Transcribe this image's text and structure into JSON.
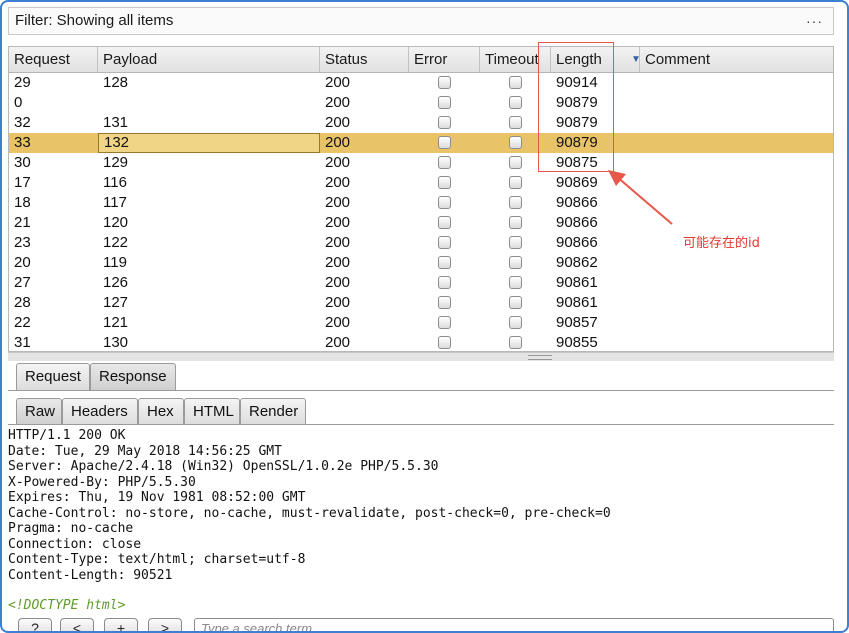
{
  "filter": {
    "text": "Filter: Showing all items",
    "menu": "···"
  },
  "columns": [
    {
      "key": "request",
      "label": "Request"
    },
    {
      "key": "payload",
      "label": "Payload"
    },
    {
      "key": "status",
      "label": "Status"
    },
    {
      "key": "error",
      "label": "Error"
    },
    {
      "key": "timeout",
      "label": "Timeout"
    },
    {
      "key": "length",
      "label": "Length",
      "sorted": "desc"
    },
    {
      "key": "comment",
      "label": "Comment"
    }
  ],
  "sort_icon": "sort-desc-icon",
  "rows": [
    {
      "request": "29",
      "payload": "128",
      "status": "200",
      "length": "90914",
      "selected": false
    },
    {
      "request": "0",
      "payload": "",
      "status": "200",
      "length": "90879",
      "selected": false
    },
    {
      "request": "32",
      "payload": "131",
      "status": "200",
      "length": "90879",
      "selected": false
    },
    {
      "request": "33",
      "payload": "132",
      "status": "200",
      "length": "90879",
      "selected": true
    },
    {
      "request": "30",
      "payload": "129",
      "status": "200",
      "length": "90875",
      "selected": false
    },
    {
      "request": "17",
      "payload": "116",
      "status": "200",
      "length": "90869",
      "selected": false
    },
    {
      "request": "18",
      "payload": "117",
      "status": "200",
      "length": "90866",
      "selected": false
    },
    {
      "request": "21",
      "payload": "120",
      "status": "200",
      "length": "90866",
      "selected": false
    },
    {
      "request": "23",
      "payload": "122",
      "status": "200",
      "length": "90866",
      "selected": false
    },
    {
      "request": "20",
      "payload": "119",
      "status": "200",
      "length": "90862",
      "selected": false
    },
    {
      "request": "27",
      "payload": "126",
      "status": "200",
      "length": "90861",
      "selected": false
    },
    {
      "request": "28",
      "payload": "127",
      "status": "200",
      "length": "90861",
      "selected": false
    },
    {
      "request": "22",
      "payload": "121",
      "status": "200",
      "length": "90857",
      "selected": false
    },
    {
      "request": "31",
      "payload": "130",
      "status": "200",
      "length": "90855",
      "selected": false
    }
  ],
  "tabs_top": [
    {
      "label": "Request",
      "active": false
    },
    {
      "label": "Response",
      "active": true
    }
  ],
  "tabs_view": [
    {
      "label": "Raw",
      "active": true
    },
    {
      "label": "Headers",
      "active": false
    },
    {
      "label": "Hex",
      "active": false
    },
    {
      "label": "HTML",
      "active": false
    },
    {
      "label": "Render",
      "active": false
    }
  ],
  "response_lines": [
    "HTTP/1.1 200 OK",
    "Date: Tue, 29 May 2018 14:56:25 GMT",
    "Server: Apache/2.4.18 (Win32) OpenSSL/1.0.2e PHP/5.5.30",
    "X-Powered-By: PHP/5.5.30",
    "Expires: Thu, 19 Nov 1981 08:52:00 GMT",
    "Cache-Control: no-store, no-cache, must-revalidate, post-check=0, pre-check=0",
    "Pragma: no-cache",
    "Connection: close",
    "Content-Type: text/html; charset=utf-8",
    "Content-Length: 90521"
  ],
  "doctype": "<!DOCTYPE html>",
  "bottom_buttons": [
    "?",
    "<",
    "+",
    ">"
  ],
  "search": {
    "placeholder": "Type a search term"
  },
  "annotation": {
    "label": "可能存在的id",
    "color": "#e03a2d"
  },
  "colors": {
    "selected_row": "#e8c368",
    "frame": "#3d7fd1",
    "doctype": "#5f9a2c"
  }
}
